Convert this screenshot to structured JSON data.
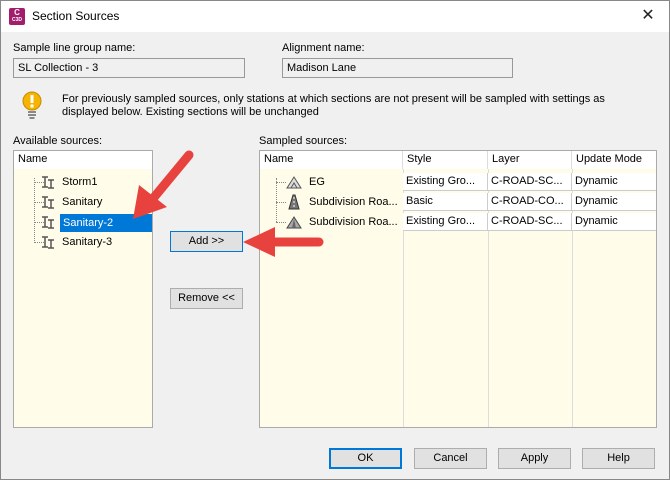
{
  "window": {
    "title": "Section Sources",
    "app_icon_letter": "C",
    "app_icon_sub": "C3D",
    "close_symbol": "✕"
  },
  "sample_line_group": {
    "label": "Sample line group name:",
    "value": "SL Collection - 3"
  },
  "alignment": {
    "label": "Alignment name:",
    "value": "Madison Lane"
  },
  "info": {
    "text": "For previously sampled sources, only stations at which sections are not present will be sampled with settings as displayed below. Existing sections will be unchanged"
  },
  "available": {
    "label": "Available sources:",
    "column": "Name",
    "items": [
      {
        "label": "Storm1"
      },
      {
        "label": "Sanitary"
      },
      {
        "label": "Sanitary-2"
      },
      {
        "label": "Sanitary-3"
      }
    ]
  },
  "buttons_mid": {
    "add": "Add >>",
    "remove": "Remove <<"
  },
  "sampled": {
    "label": "Sampled sources:",
    "columns": [
      "Name",
      "Style",
      "Layer",
      "Update Mode"
    ],
    "rows": [
      {
        "name": "EG",
        "style": "Existing Gro...",
        "layer": "C-ROAD-SC...",
        "mode": "Dynamic"
      },
      {
        "name": "Subdivision Roa...",
        "style": "Basic",
        "layer": "C-ROAD-CO...",
        "mode": "Dynamic"
      },
      {
        "name": "Subdivision Roa...",
        "style": "Existing Gro...",
        "layer": "C-ROAD-SC...",
        "mode": "Dynamic"
      }
    ]
  },
  "footer": {
    "ok": "OK",
    "cancel": "Cancel",
    "apply": "Apply",
    "help": "Help"
  },
  "colors": {
    "accent": "#0078d7",
    "panel_bg": "#fffde9",
    "arrow": "#e8423f"
  }
}
